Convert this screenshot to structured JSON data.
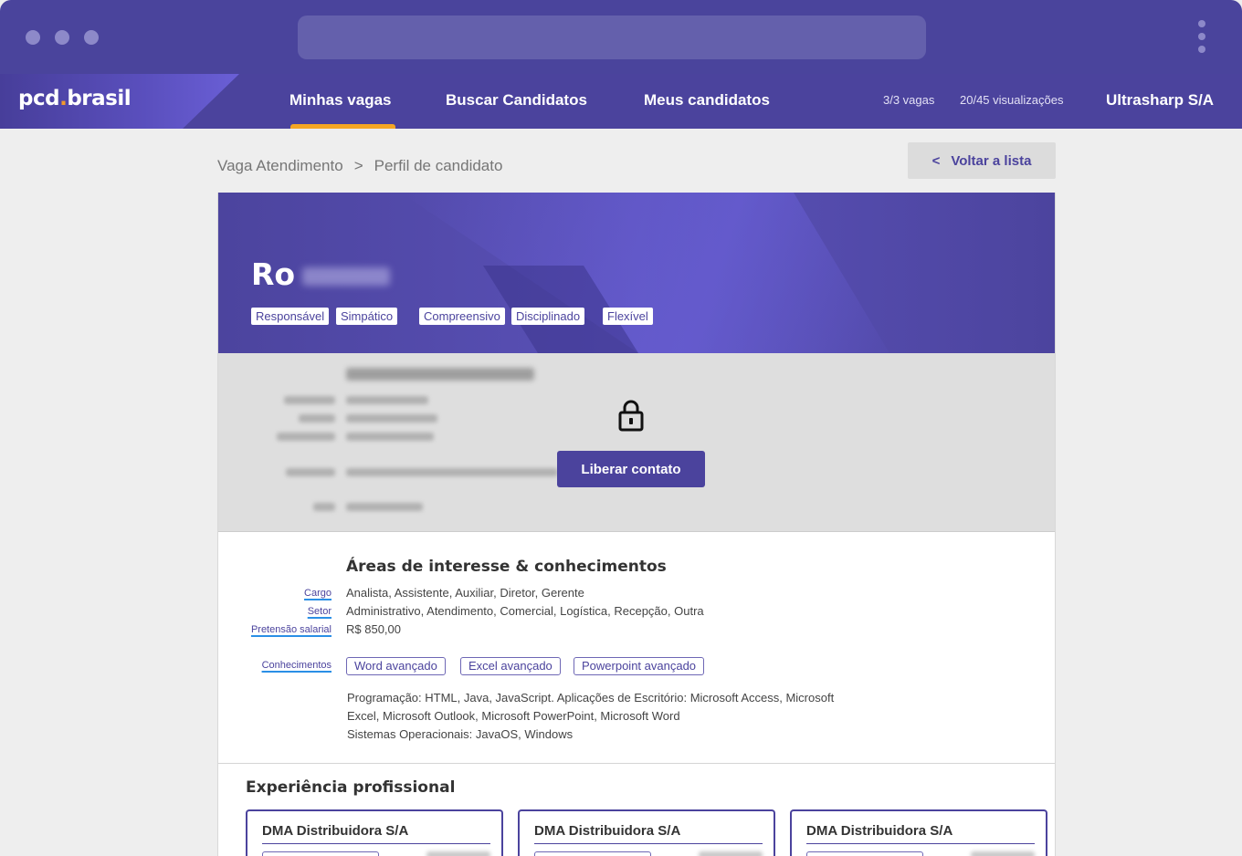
{
  "nav": {
    "logo_left": "pcd",
    "logo_dot": ".",
    "logo_right": "brasil",
    "items": [
      {
        "label": "Minhas vagas",
        "active": true
      },
      {
        "label": "Buscar Candidatos",
        "active": false
      },
      {
        "label": "Meus candidatos",
        "active": false
      }
    ],
    "vagas": "3/3 vagas",
    "visualizacoes": "20/45 visualizações",
    "company": "Ultrasharp S/A"
  },
  "breadcrumb": {
    "parent": "Vaga Atendimento",
    "separator": ">",
    "current": "Perfil de candidato"
  },
  "back_button": {
    "chevron": "<",
    "label": "Voltar a lista"
  },
  "candidate": {
    "name_visible": "Ro",
    "traits": [
      "Responsável",
      "Simpático",
      "Compreensivo",
      "Disciplinado",
      "Flexível"
    ]
  },
  "contacts": {
    "unlock_label": "Liberar contato",
    "icon": "lock-icon"
  },
  "interests": {
    "title": "Áreas de interesse & conhecimentos",
    "cargo_label": "Cargo",
    "cargo_value": "Analista, Assistente, Auxiliar, Diretor, Gerente",
    "setor_label": "Setor",
    "setor_value": "Administrativo, Atendimento, Comercial, Logística, Recepção, Outra",
    "salario_label": "Pretensão salarial",
    "salario_value": "R$ 850,00",
    "conhecimentos_label": "Conhecimentos",
    "skills": [
      "Word avançado",
      "Excel avançado",
      "Powerpoint avançado"
    ],
    "desc_line1": "Programação: HTML, Java, JavaScript. Aplicações de Escritório: Microsoft Access, Microsoft",
    "desc_line2": "Excel, Microsoft Outlook, Microsoft PowerPoint, Microsoft Word",
    "desc_line3": "Sistemas Operacionais: JavaOS, Windows"
  },
  "experience": {
    "title": "Experiência profissional",
    "cards": [
      {
        "company": "DMA Distribuidora S/A"
      },
      {
        "company": "DMA Distribuidora S/A"
      },
      {
        "company": "DMA Distribuidora S/A"
      }
    ]
  },
  "colors": {
    "primary": "#4b439d",
    "accent": "#f5a623",
    "link_underline": "#2a8fe6"
  }
}
